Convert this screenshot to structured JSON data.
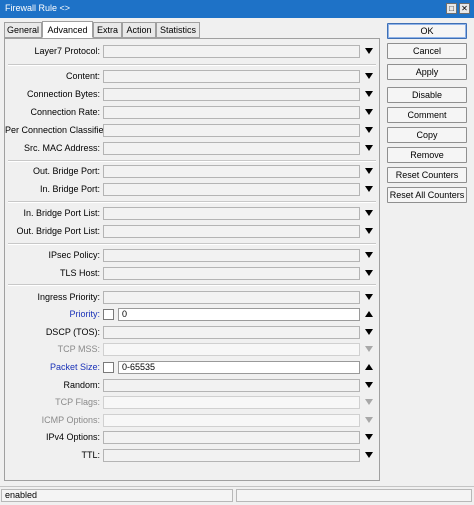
{
  "window": {
    "title": "Firewall Rule <>",
    "restore_glyph": "□",
    "close_glyph": "✕"
  },
  "tabs": [
    "General",
    "Advanced",
    "Extra",
    "Action",
    "Statistics"
  ],
  "active_tab": "Advanced",
  "fields": {
    "layer7_protocol": {
      "label": "Layer7 Protocol:",
      "value": ""
    },
    "content": {
      "label": "Content:",
      "value": ""
    },
    "connection_bytes": {
      "label": "Connection Bytes:",
      "value": ""
    },
    "connection_rate": {
      "label": "Connection Rate:",
      "value": ""
    },
    "per_connection_classifier": {
      "label": "Per Connection Classifier:",
      "value": ""
    },
    "src_mac_address": {
      "label": "Src. MAC Address:",
      "value": ""
    },
    "out_bridge_port": {
      "label": "Out. Bridge Port:",
      "value": ""
    },
    "in_bridge_port": {
      "label": "In. Bridge Port:",
      "value": ""
    },
    "in_bridge_port_list": {
      "label": "In. Bridge Port List:",
      "value": ""
    },
    "out_bridge_port_list": {
      "label": "Out. Bridge Port List:",
      "value": ""
    },
    "ipsec_policy": {
      "label": "IPsec Policy:",
      "value": ""
    },
    "tls_host": {
      "label": "TLS Host:",
      "value": ""
    },
    "ingress_priority": {
      "label": "Ingress Priority:",
      "value": ""
    },
    "priority": {
      "label": "Priority:",
      "value": "0"
    },
    "dscp_tos": {
      "label": "DSCP (TOS):",
      "value": ""
    },
    "tcp_mss": {
      "label": "TCP MSS:",
      "value": ""
    },
    "packet_size": {
      "label": "Packet Size:",
      "value": "0-65535"
    },
    "random": {
      "label": "Random:",
      "value": ""
    },
    "tcp_flags": {
      "label": "TCP Flags:",
      "value": ""
    },
    "icmp_options": {
      "label": "ICMP Options:",
      "value": ""
    },
    "ipv4_options": {
      "label": "IPv4 Options:",
      "value": ""
    },
    "ttl": {
      "label": "TTL:",
      "value": ""
    }
  },
  "buttons": {
    "ok": "OK",
    "cancel": "Cancel",
    "apply": "Apply",
    "disable": "Disable",
    "comment": "Comment",
    "copy": "Copy",
    "remove": "Remove",
    "reset_counters": "Reset Counters",
    "reset_all_counters": "Reset All Counters"
  },
  "status": {
    "left": "enabled",
    "right": ""
  },
  "colors": {
    "titlebar": "#1e72c7",
    "highlight_label": "#1a32b8",
    "disabled_label": "#8a8a8a"
  }
}
